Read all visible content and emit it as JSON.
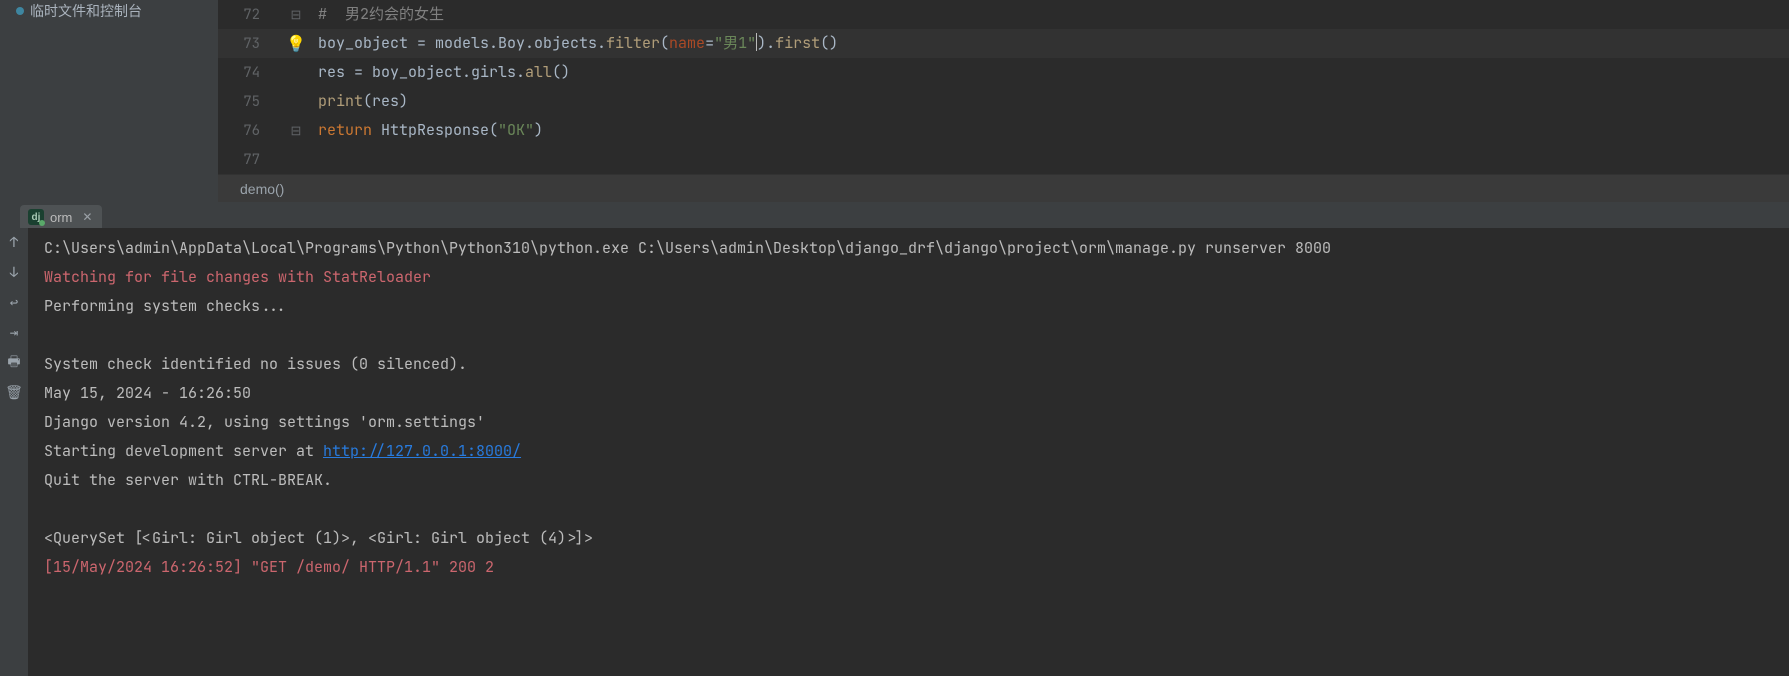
{
  "sidebar": {
    "item_label": "临时文件和控制台"
  },
  "editor": {
    "lines": [
      {
        "num": "72",
        "fold": "open-top",
        "bulb": false
      },
      {
        "num": "73",
        "fold": "",
        "bulb": true
      },
      {
        "num": "74",
        "fold": "",
        "bulb": false
      },
      {
        "num": "75",
        "fold": "",
        "bulb": false
      },
      {
        "num": "76",
        "fold": "close",
        "bulb": false
      },
      {
        "num": "77",
        "fold": "",
        "bulb": false
      }
    ],
    "code": {
      "l72_comment": "#  男2约会的女生",
      "l73_pre": "boy_object = models.Boy.objects.",
      "l73_filter": "filter",
      "l73_open": "(",
      "l73_param": "name",
      "l73_eq": "=",
      "l73_str": "\"男1\"",
      "l73_close": ").",
      "l73_first": "first",
      "l73_tail": "()",
      "l74": "res = boy_object.girls.",
      "l74_all": "all",
      "l74_tail": "()",
      "l75_print": "print",
      "l75_arg": "(res)",
      "l76_return": "return ",
      "l76_call": "HttpResponse(",
      "l76_str": "\"OK\"",
      "l76_close": ")"
    },
    "breadcrumb": "demo()"
  },
  "run": {
    "tab_label": "orm",
    "console": {
      "l1": "C:\\Users\\admin\\AppData\\Local\\Programs\\Python\\Python310\\python.exe C:\\Users\\admin\\Desktop\\django_drf\\django\\project\\orm\\manage.py runserver 8000",
      "l2": "Watching for file changes with StatReloader",
      "l3": "Performing system checks...",
      "l4": "",
      "l5": "System check identified no issues (0 silenced).",
      "l6": "May 15, 2024 - 16:26:50",
      "l7": "Django version 4.2, using settings 'orm.settings'",
      "l8_pre": "Starting development server at ",
      "l8_link": "http://127.0.0.1:8000/",
      "l9": "Quit the server with CTRL-BREAK.",
      "l10": "",
      "l11": "<QuerySet [<Girl: Girl object (1)>, <Girl: Girl object (4)>]>",
      "l12": "[15/May/2024 16:26:52] \"GET /demo/ HTTP/1.1\" 200 2"
    }
  }
}
